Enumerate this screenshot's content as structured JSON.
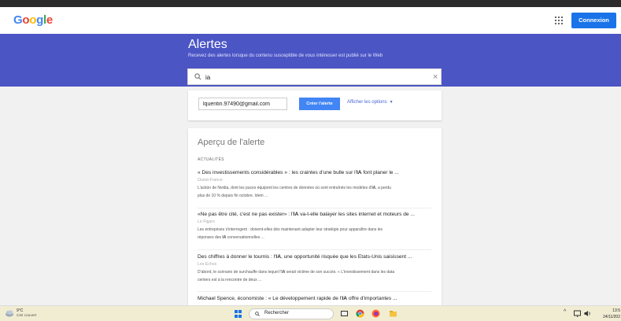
{
  "header": {
    "logo": "Google",
    "signin_label": "Connexion"
  },
  "hero": {
    "title": "Alertes",
    "subtitle": "Recevez des alertes lorsque du contenu susceptible de vous intéresser est publié sur le Web",
    "search_value": "ia",
    "clear_symbol": "×"
  },
  "create": {
    "email": "lquentin.97490@gmail.com",
    "button_label": "Créer l'alerte",
    "options_label": "Afficher les options",
    "options_caret": "▼"
  },
  "preview": {
    "heading": "Aperçu de l'alerte",
    "section": "ACTUALITÉS",
    "articles": [
      {
        "title_before": "« Des investissements considérables » : les craintes d'une bulle sur l'",
        "title_bold": "IA",
        "title_after": " font planer le ...",
        "source": "Ouest-France",
        "summary_1": "L'action de Nvidia, dont les puces équipent les centres de données où sont entraînés les modèles d'",
        "summary_bold": "IA",
        "summary_2": ", a perdu",
        "summary_line2": "plus de 10 % depuis fin octobre. Idem ..."
      },
      {
        "title_before": "«Ne pas être cité, c'est ne pas exister» : l'",
        "title_bold": "IA",
        "title_after": " va-t-elle balayer les sites internet et moteurs de ...",
        "source": "Le Figaro",
        "summary_1": "Les entreprises s'interrogent : doivent-elles dès maintenant adapter leur stratégie pour apparaître dans les",
        "summary_bold": "",
        "summary_2": "",
        "summary_line2_before": "réponses des ",
        "summary_line2_bold": "IA",
        "summary_line2_after": " conversationnelles ..."
      },
      {
        "title_before": "Des chiffres à donner le tournis : l'",
        "title_bold": "IA",
        "title_after": ", une opportunité risquée que les Etats-Unis saisissent ...",
        "source": "Les Echos",
        "summary_1": "D'abord, le scénario de surchauffe dans lequel l'",
        "summary_bold": "IA",
        "summary_2": " serait victime de son succès. « L'investissement dans les data",
        "summary_line2": "centers est à la rencontre de deux ..."
      },
      {
        "title_before": "Michael Spence, économiste : « Le développement rapide de l'",
        "title_bold": "IA",
        "title_after": " offre d'importantes ..."
      }
    ]
  },
  "taskbar": {
    "temperature": "9°C",
    "condition": "Ciel couvert",
    "search_label": "Rechercher",
    "time": "13:5",
    "date": "24/11/202"
  }
}
